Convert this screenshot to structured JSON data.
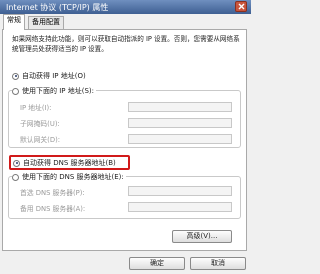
{
  "window": {
    "title": "Internet 协议 (TCP/IP) 属性"
  },
  "tabs": [
    {
      "label": "常规"
    },
    {
      "label": "备用配置"
    }
  ],
  "general": {
    "description": "如果网络支持此功能，则可以获取自动指派的 IP 设置。否则，您需要从网络系统管理员处获得适当的 IP 设置。",
    "ip_auto_label": "自动获得 IP 地址(O)",
    "ip_manual_label": "使用下面的 IP 地址(S):",
    "ip_address_label": "IP 地址(I):",
    "subnet_mask_label": "子网掩码(U):",
    "gateway_label": "默认网关(D):",
    "dns_auto_label": "自动获得 DNS 服务器地址(B)",
    "dns_manual_label": "使用下面的 DNS 服务器地址(E):",
    "dns_preferred_label": "首选 DNS 服务器(P):",
    "dns_alternate_label": "备用 DNS 服务器(A):",
    "advanced_button": "高级(V)...",
    "ip_mode": "auto",
    "dns_mode": "auto"
  },
  "footer": {
    "ok_button": "确定",
    "cancel_button": "取消"
  },
  "colors": {
    "title_bar": "#3e5f92",
    "highlight_border": "#d11a1a",
    "close_button": "#c8553d"
  }
}
